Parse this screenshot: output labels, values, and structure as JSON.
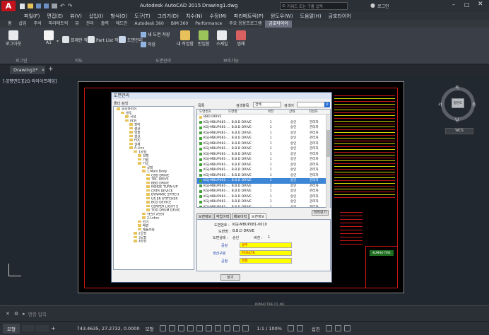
{
  "titlebar": {
    "app_title": "Autodesk AutoCAD 2015",
    "document": "Drawing1.dwg",
    "search_placeholder": "키워드 또는 구를 입력",
    "user": "로그인"
  },
  "menu": [
    "파일(F)",
    "편집(E)",
    "뷰(V)",
    "삽입(I)",
    "형식(O)",
    "도구(T)",
    "그리기(D)",
    "치수(N)",
    "수정(M)",
    "파라메트릭(P)",
    "윈도우(W)",
    "도움말(H)",
    "금호타이어"
  ],
  "ribbon_tabs": [
    "홈",
    "삽입",
    "주석",
    "파라메트릭",
    "뷰",
    "관리",
    "출력",
    "애드인",
    "Autodesk 360",
    "BIM 360",
    "Performance",
    "주요 응용프로그램",
    "금호타이어"
  ],
  "ribbon": {
    "buttons": [
      "로그아웃",
      "A1",
      "표제란 작성",
      "Part List 작성",
      "도면관리",
      "새 도면 저장",
      "저장",
      "내 작업함",
      "반입함",
      "스케일",
      "범례"
    ],
    "groups": [
      "로그인",
      "작도",
      "도면관리",
      "보조기능"
    ]
  },
  "doc_tab": "Drawing1*",
  "viewport_label": "[-][평면도][2D 와이어프레임]",
  "viewcube": {
    "n": "북",
    "s": "남",
    "w": "서",
    "e": "동",
    "center": "평면도",
    "wcs": "WCS"
  },
  "dialog": {
    "title": "도면관리",
    "tree_label": "폴더 검색",
    "tree": [
      "금호타이어",
      "광주",
      "곡성",
      "PCR",
      "장비",
      "생산",
      "입출",
      "생산",
      "FDC",
      "설계",
      "A-Line",
      "1공장",
      "성형",
      "가류",
      "가공",
      "공정",
      "1.Main Body",
      "CBD DRIVE",
      "TBC DRIVE",
      "BBD DRIVE",
      "INSIDE TURN UP",
      "CRTR DEVICE",
      "DYNAMIC STITCH",
      "UP,ER STITCHER",
      "BCD DEVICE",
      "CENTER LIGHT S",
      "TOD DRUM DEVIC",
      "TEST ASSY",
      "2.Lobss",
      "전기",
      "배관",
      "제품이송",
      "2공장",
      "3공장",
      "4공장"
    ],
    "filter": {
      "label": "목록",
      "search_by_label": "검색항목",
      "search_by_value": "전체",
      "search_label": "검색어"
    },
    "columns": [
      "도면번호",
      "도면명",
      "버전",
      "상태",
      "작성자"
    ],
    "group_row": "BBD DRIVE",
    "rows": [
      [
        "KGJ-MBUP081-...",
        "B.B.D DRIVE",
        "1",
        "승인",
        "관리자"
      ],
      [
        "KGJ-MBUP081-...",
        "B.B.D DRIVE",
        "1",
        "승인",
        "관리자"
      ],
      [
        "KGJ-MBUP081-...",
        "B.B.D DRIVE",
        "1",
        "승인",
        "관리자"
      ],
      [
        "KGJ-MBUP081-...",
        "B.B.D DRIVE",
        "1",
        "승인",
        "관리자"
      ],
      [
        "KGJ-MBUP081-...",
        "B.B.D DRIVE",
        "1",
        "승인",
        "관리자"
      ],
      [
        "KGJ-MBUP081-...",
        "B.B.D DRIVE",
        "1",
        "승인",
        "관리자"
      ],
      [
        "KGJ-MBUP081-...",
        "B.B.D DRIVE",
        "1",
        "승인",
        "관리자"
      ],
      [
        "KGJ-MBUP081-...",
        "B.B.D DRIVE",
        "1",
        "승인",
        "관리자"
      ],
      [
        "KGJ-MBUP081-...",
        "B.B.D DRIVE",
        "1",
        "승인",
        "관리자"
      ],
      [
        "KGJ-MBUP081-...",
        "B.B.D DRIVE",
        "1",
        "승인",
        "관리자"
      ],
      [
        "KGJ-MBUP081-...",
        "B.B.D DRIVE",
        "1",
        "승인",
        "관리자"
      ],
      [
        "KGJ-MBUP081-...",
        "B.B.D DRIVE",
        "1",
        "승인",
        "관리자"
      ],
      [
        "KGJ-MBUP081-...",
        "B.B.D DRIVE",
        "1",
        "승인",
        "관리자"
      ],
      [
        "KGJ-MBUP081-...",
        "B.B.D DRIVE",
        "1",
        "승인",
        "관리자"
      ],
      [
        "KGJ-MBUP081-...",
        "B.B.D DRIVE",
        "1",
        "승인",
        "관리자"
      ],
      [
        "KGJ-MBUP081-...",
        "B.B.D DRIVE",
        "1",
        "승인",
        "관리자"
      ],
      [
        "KGJ-MBUP081-...",
        "B.B.D DRIVE",
        "1",
        "승인",
        "관리자"
      ],
      [
        "KGJ-MBUP081-...",
        "B.B.D DRIVE",
        "1",
        "승인",
        "관리자"
      ],
      [
        "KGJ-MBUP081-...",
        "B.B.D DRIVE",
        "1",
        "승인",
        "관리자"
      ]
    ],
    "selected_index": 11,
    "detail_tabs": [
      "도면정보",
      "작업이력",
      "배포이력",
      "도면정보"
    ],
    "detail_button": "미리보기",
    "fields": {
      "drawing_no_label": "도면번호 :",
      "drawing_no": "KGJ-MBUP081-0010",
      "drawing_name_label": "도면명 :",
      "drawing_name": "B.B.D DRIVE",
      "status_label": "도면상태 :",
      "status": "승인",
      "version_label": "버전 :",
      "version": "1"
    },
    "yellow_fields": [
      {
        "label": "공장",
        "value": "광주"
      },
      {
        "label": "생산구분",
        "value": "PCR/LTR"
      },
      {
        "label": "공정",
        "value": "성형"
      }
    ],
    "close_button": "닫기"
  },
  "drawing": {
    "company": "KUMHO TIRE CO.,INC",
    "logo": "KUMHO TIRE"
  },
  "command": {
    "placeholder": "명령 입력"
  },
  "status": {
    "layout_tab": "모형",
    "coords": "743.4635, 27.2732, 0.0000",
    "mode": "모형",
    "scale": "1:1 / 100%",
    "units": "십진"
  },
  "colors": {
    "accent": "#3d86d6",
    "drawing_red": "#c81414",
    "yellow": "#ffff00"
  }
}
